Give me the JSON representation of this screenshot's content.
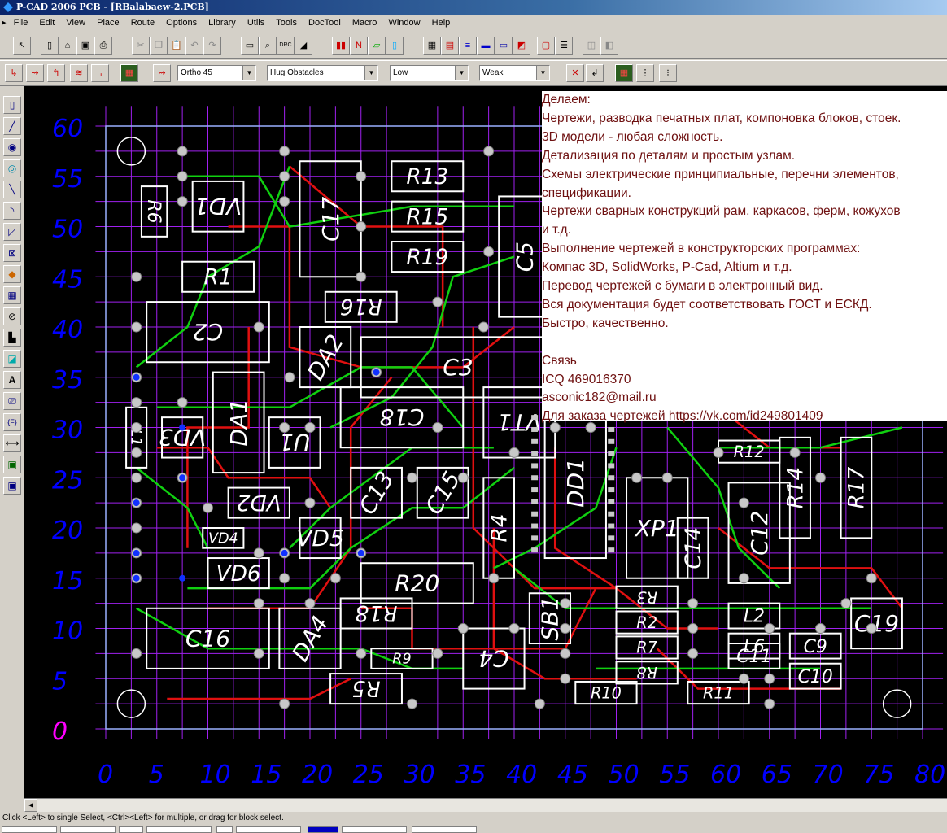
{
  "window": {
    "title": "P-CAD 2006 PCB - [RBalabaew-2.PCB]"
  },
  "menu": [
    "File",
    "Edit",
    "View",
    "Place",
    "Route",
    "Options",
    "Library",
    "Utils",
    "Tools",
    "DocTool",
    "Macro",
    "Window",
    "Help"
  ],
  "toolbar2": {
    "route_mode": "Ortho 45",
    "obstacle_mode": "Hug Obstacles",
    "optimization": "Low",
    "strength": "Weak"
  },
  "board": {
    "y_axis": [
      "60",
      "55",
      "50",
      "45",
      "40",
      "35",
      "30",
      "25",
      "20",
      "15",
      "10",
      "5",
      "0"
    ],
    "x_axis": [
      "0",
      "5",
      "10",
      "15",
      "20",
      "25",
      "30",
      "35",
      "40",
      "45",
      "50",
      "55",
      "60",
      "65",
      "70",
      "75",
      "80"
    ],
    "components": [
      "R6",
      "VD1",
      "C17",
      "R13",
      "R15",
      "R19",
      "C5",
      "R1",
      "C2",
      "R16",
      "DA2",
      "C3",
      "VD3",
      "L1",
      "DA1",
      "U1",
      "C18",
      "VT1",
      "DD1",
      "R12",
      "R14",
      "R17",
      "VD2",
      "C13",
      "C15",
      "XP1",
      "C12",
      "R4",
      "C14",
      "VD4",
      "VD5",
      "VD6",
      "R20",
      "R3",
      "R2",
      "R7",
      "R8",
      "L2",
      "L6",
      "L3",
      "SB1",
      "C16",
      "R18",
      "DA4",
      "R9",
      "C4",
      "R10",
      "R11",
      "C11",
      "C9",
      "C10",
      "C19",
      "R5"
    ]
  },
  "ad": {
    "lines": [
      "Делаем:",
      "Чертежи, разводка печатных плат, компоновка блоков, стоек.",
      "3D модели - любая сложность.",
      "Детализация по деталям и простым узлам.",
      "Схемы электрические принципиальные, перечни элементов,",
      "спецификации.",
      "Чертежи сварных конструкций рам, каркасов, ферм, кожухов",
      "и т.д.",
      "Выполнение чертежей в конструкторских программах:",
      "Компас 3D, SolidWorks, P-Cad, Altium и т.д.",
      "Перевод чертежей с бумаги в электронный вид.",
      "Вся документация будет соответствовать ГОСТ и ЕСКД.",
      "Быстро, качественно.",
      "",
      "Связь",
      "ICQ 469016370",
      "asconic182@mail.ru",
      "Для заказа чертежей https://vk.com/id249801409"
    ]
  },
  "status": {
    "hint": "Click <Left> to single Select, <Ctrl><Left> for multiple, or drag for block select."
  },
  "colors": {
    "axis_label": "#0000ff",
    "zero_label": "#ff00ff",
    "grid": "#a020f0",
    "trace_red": "#e01010",
    "trace_green": "#10d010",
    "silk": "#ffffff",
    "ad_text": "#6e1010"
  }
}
